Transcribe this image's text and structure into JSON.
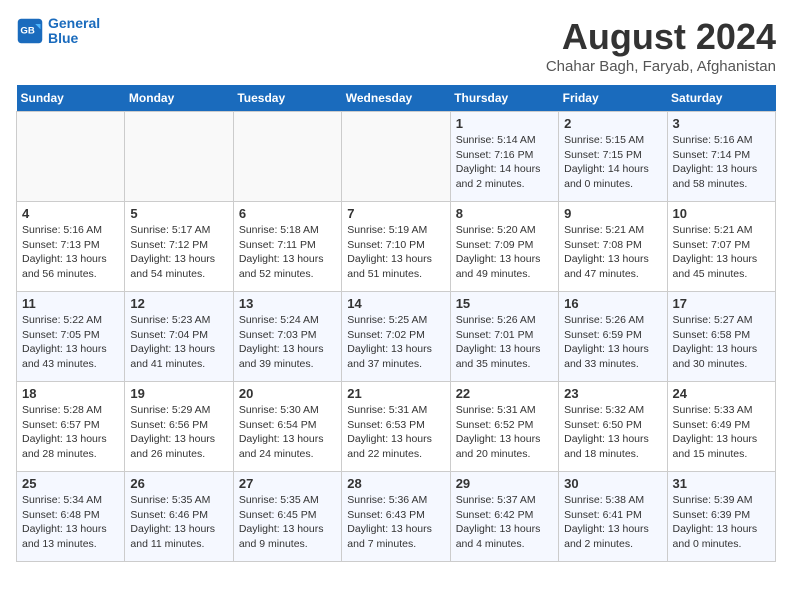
{
  "logo": {
    "line1": "General",
    "line2": "Blue"
  },
  "title": "August 2024",
  "subtitle": "Chahar Bagh, Faryab, Afghanistan",
  "headers": [
    "Sunday",
    "Monday",
    "Tuesday",
    "Wednesday",
    "Thursday",
    "Friday",
    "Saturday"
  ],
  "weeks": [
    [
      {
        "day": "",
        "text": ""
      },
      {
        "day": "",
        "text": ""
      },
      {
        "day": "",
        "text": ""
      },
      {
        "day": "",
        "text": ""
      },
      {
        "day": "1",
        "text": "Sunrise: 5:14 AM\nSunset: 7:16 PM\nDaylight: 14 hours\nand 2 minutes."
      },
      {
        "day": "2",
        "text": "Sunrise: 5:15 AM\nSunset: 7:15 PM\nDaylight: 14 hours\nand 0 minutes."
      },
      {
        "day": "3",
        "text": "Sunrise: 5:16 AM\nSunset: 7:14 PM\nDaylight: 13 hours\nand 58 minutes."
      }
    ],
    [
      {
        "day": "4",
        "text": "Sunrise: 5:16 AM\nSunset: 7:13 PM\nDaylight: 13 hours\nand 56 minutes."
      },
      {
        "day": "5",
        "text": "Sunrise: 5:17 AM\nSunset: 7:12 PM\nDaylight: 13 hours\nand 54 minutes."
      },
      {
        "day": "6",
        "text": "Sunrise: 5:18 AM\nSunset: 7:11 PM\nDaylight: 13 hours\nand 52 minutes."
      },
      {
        "day": "7",
        "text": "Sunrise: 5:19 AM\nSunset: 7:10 PM\nDaylight: 13 hours\nand 51 minutes."
      },
      {
        "day": "8",
        "text": "Sunrise: 5:20 AM\nSunset: 7:09 PM\nDaylight: 13 hours\nand 49 minutes."
      },
      {
        "day": "9",
        "text": "Sunrise: 5:21 AM\nSunset: 7:08 PM\nDaylight: 13 hours\nand 47 minutes."
      },
      {
        "day": "10",
        "text": "Sunrise: 5:21 AM\nSunset: 7:07 PM\nDaylight: 13 hours\nand 45 minutes."
      }
    ],
    [
      {
        "day": "11",
        "text": "Sunrise: 5:22 AM\nSunset: 7:05 PM\nDaylight: 13 hours\nand 43 minutes."
      },
      {
        "day": "12",
        "text": "Sunrise: 5:23 AM\nSunset: 7:04 PM\nDaylight: 13 hours\nand 41 minutes."
      },
      {
        "day": "13",
        "text": "Sunrise: 5:24 AM\nSunset: 7:03 PM\nDaylight: 13 hours\nand 39 minutes."
      },
      {
        "day": "14",
        "text": "Sunrise: 5:25 AM\nSunset: 7:02 PM\nDaylight: 13 hours\nand 37 minutes."
      },
      {
        "day": "15",
        "text": "Sunrise: 5:26 AM\nSunset: 7:01 PM\nDaylight: 13 hours\nand 35 minutes."
      },
      {
        "day": "16",
        "text": "Sunrise: 5:26 AM\nSunset: 6:59 PM\nDaylight: 13 hours\nand 33 minutes."
      },
      {
        "day": "17",
        "text": "Sunrise: 5:27 AM\nSunset: 6:58 PM\nDaylight: 13 hours\nand 30 minutes."
      }
    ],
    [
      {
        "day": "18",
        "text": "Sunrise: 5:28 AM\nSunset: 6:57 PM\nDaylight: 13 hours\nand 28 minutes."
      },
      {
        "day": "19",
        "text": "Sunrise: 5:29 AM\nSunset: 6:56 PM\nDaylight: 13 hours\nand 26 minutes."
      },
      {
        "day": "20",
        "text": "Sunrise: 5:30 AM\nSunset: 6:54 PM\nDaylight: 13 hours\nand 24 minutes."
      },
      {
        "day": "21",
        "text": "Sunrise: 5:31 AM\nSunset: 6:53 PM\nDaylight: 13 hours\nand 22 minutes."
      },
      {
        "day": "22",
        "text": "Sunrise: 5:31 AM\nSunset: 6:52 PM\nDaylight: 13 hours\nand 20 minutes."
      },
      {
        "day": "23",
        "text": "Sunrise: 5:32 AM\nSunset: 6:50 PM\nDaylight: 13 hours\nand 18 minutes."
      },
      {
        "day": "24",
        "text": "Sunrise: 5:33 AM\nSunset: 6:49 PM\nDaylight: 13 hours\nand 15 minutes."
      }
    ],
    [
      {
        "day": "25",
        "text": "Sunrise: 5:34 AM\nSunset: 6:48 PM\nDaylight: 13 hours\nand 13 minutes."
      },
      {
        "day": "26",
        "text": "Sunrise: 5:35 AM\nSunset: 6:46 PM\nDaylight: 13 hours\nand 11 minutes."
      },
      {
        "day": "27",
        "text": "Sunrise: 5:35 AM\nSunset: 6:45 PM\nDaylight: 13 hours\nand 9 minutes."
      },
      {
        "day": "28",
        "text": "Sunrise: 5:36 AM\nSunset: 6:43 PM\nDaylight: 13 hours\nand 7 minutes."
      },
      {
        "day": "29",
        "text": "Sunrise: 5:37 AM\nSunset: 6:42 PM\nDaylight: 13 hours\nand 4 minutes."
      },
      {
        "day": "30",
        "text": "Sunrise: 5:38 AM\nSunset: 6:41 PM\nDaylight: 13 hours\nand 2 minutes."
      },
      {
        "day": "31",
        "text": "Sunrise: 5:39 AM\nSunset: 6:39 PM\nDaylight: 13 hours\nand 0 minutes."
      }
    ]
  ]
}
